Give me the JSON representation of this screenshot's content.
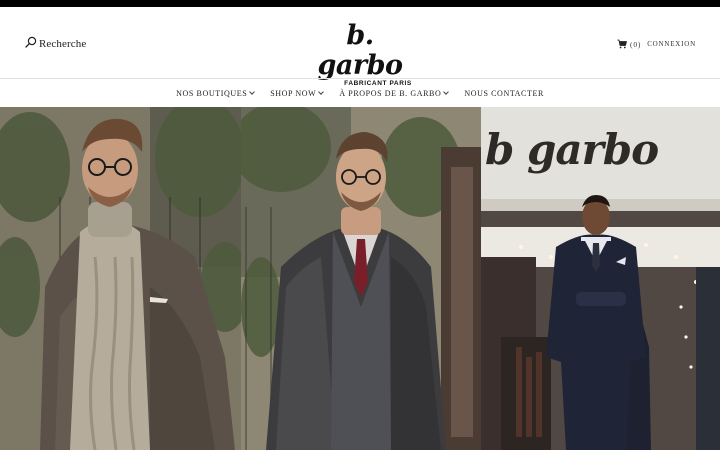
{
  "header": {
    "search_label": "Recherche",
    "logo_text": "b. garbo",
    "logo_subtitle": "FABRICANT PARIS",
    "cart_count": "(0)",
    "login_label": "CONNEXION"
  },
  "nav": {
    "items": [
      {
        "label": "NOS BOUTIQUES",
        "dropdown": true
      },
      {
        "label": "SHOP NOW",
        "dropdown": true
      },
      {
        "label": "À PROPOS DE B. GARBO",
        "dropdown": true
      },
      {
        "label": "NOUS CONTACTER",
        "dropdown": false
      }
    ]
  },
  "gallery": {
    "store_sign_text": "b garbo"
  },
  "colors": {
    "topbar": "#000000",
    "text": "#222222",
    "divider": "#e2e2e2"
  },
  "icons": [
    "search-icon",
    "cart-icon",
    "chevron-down-icon"
  ]
}
